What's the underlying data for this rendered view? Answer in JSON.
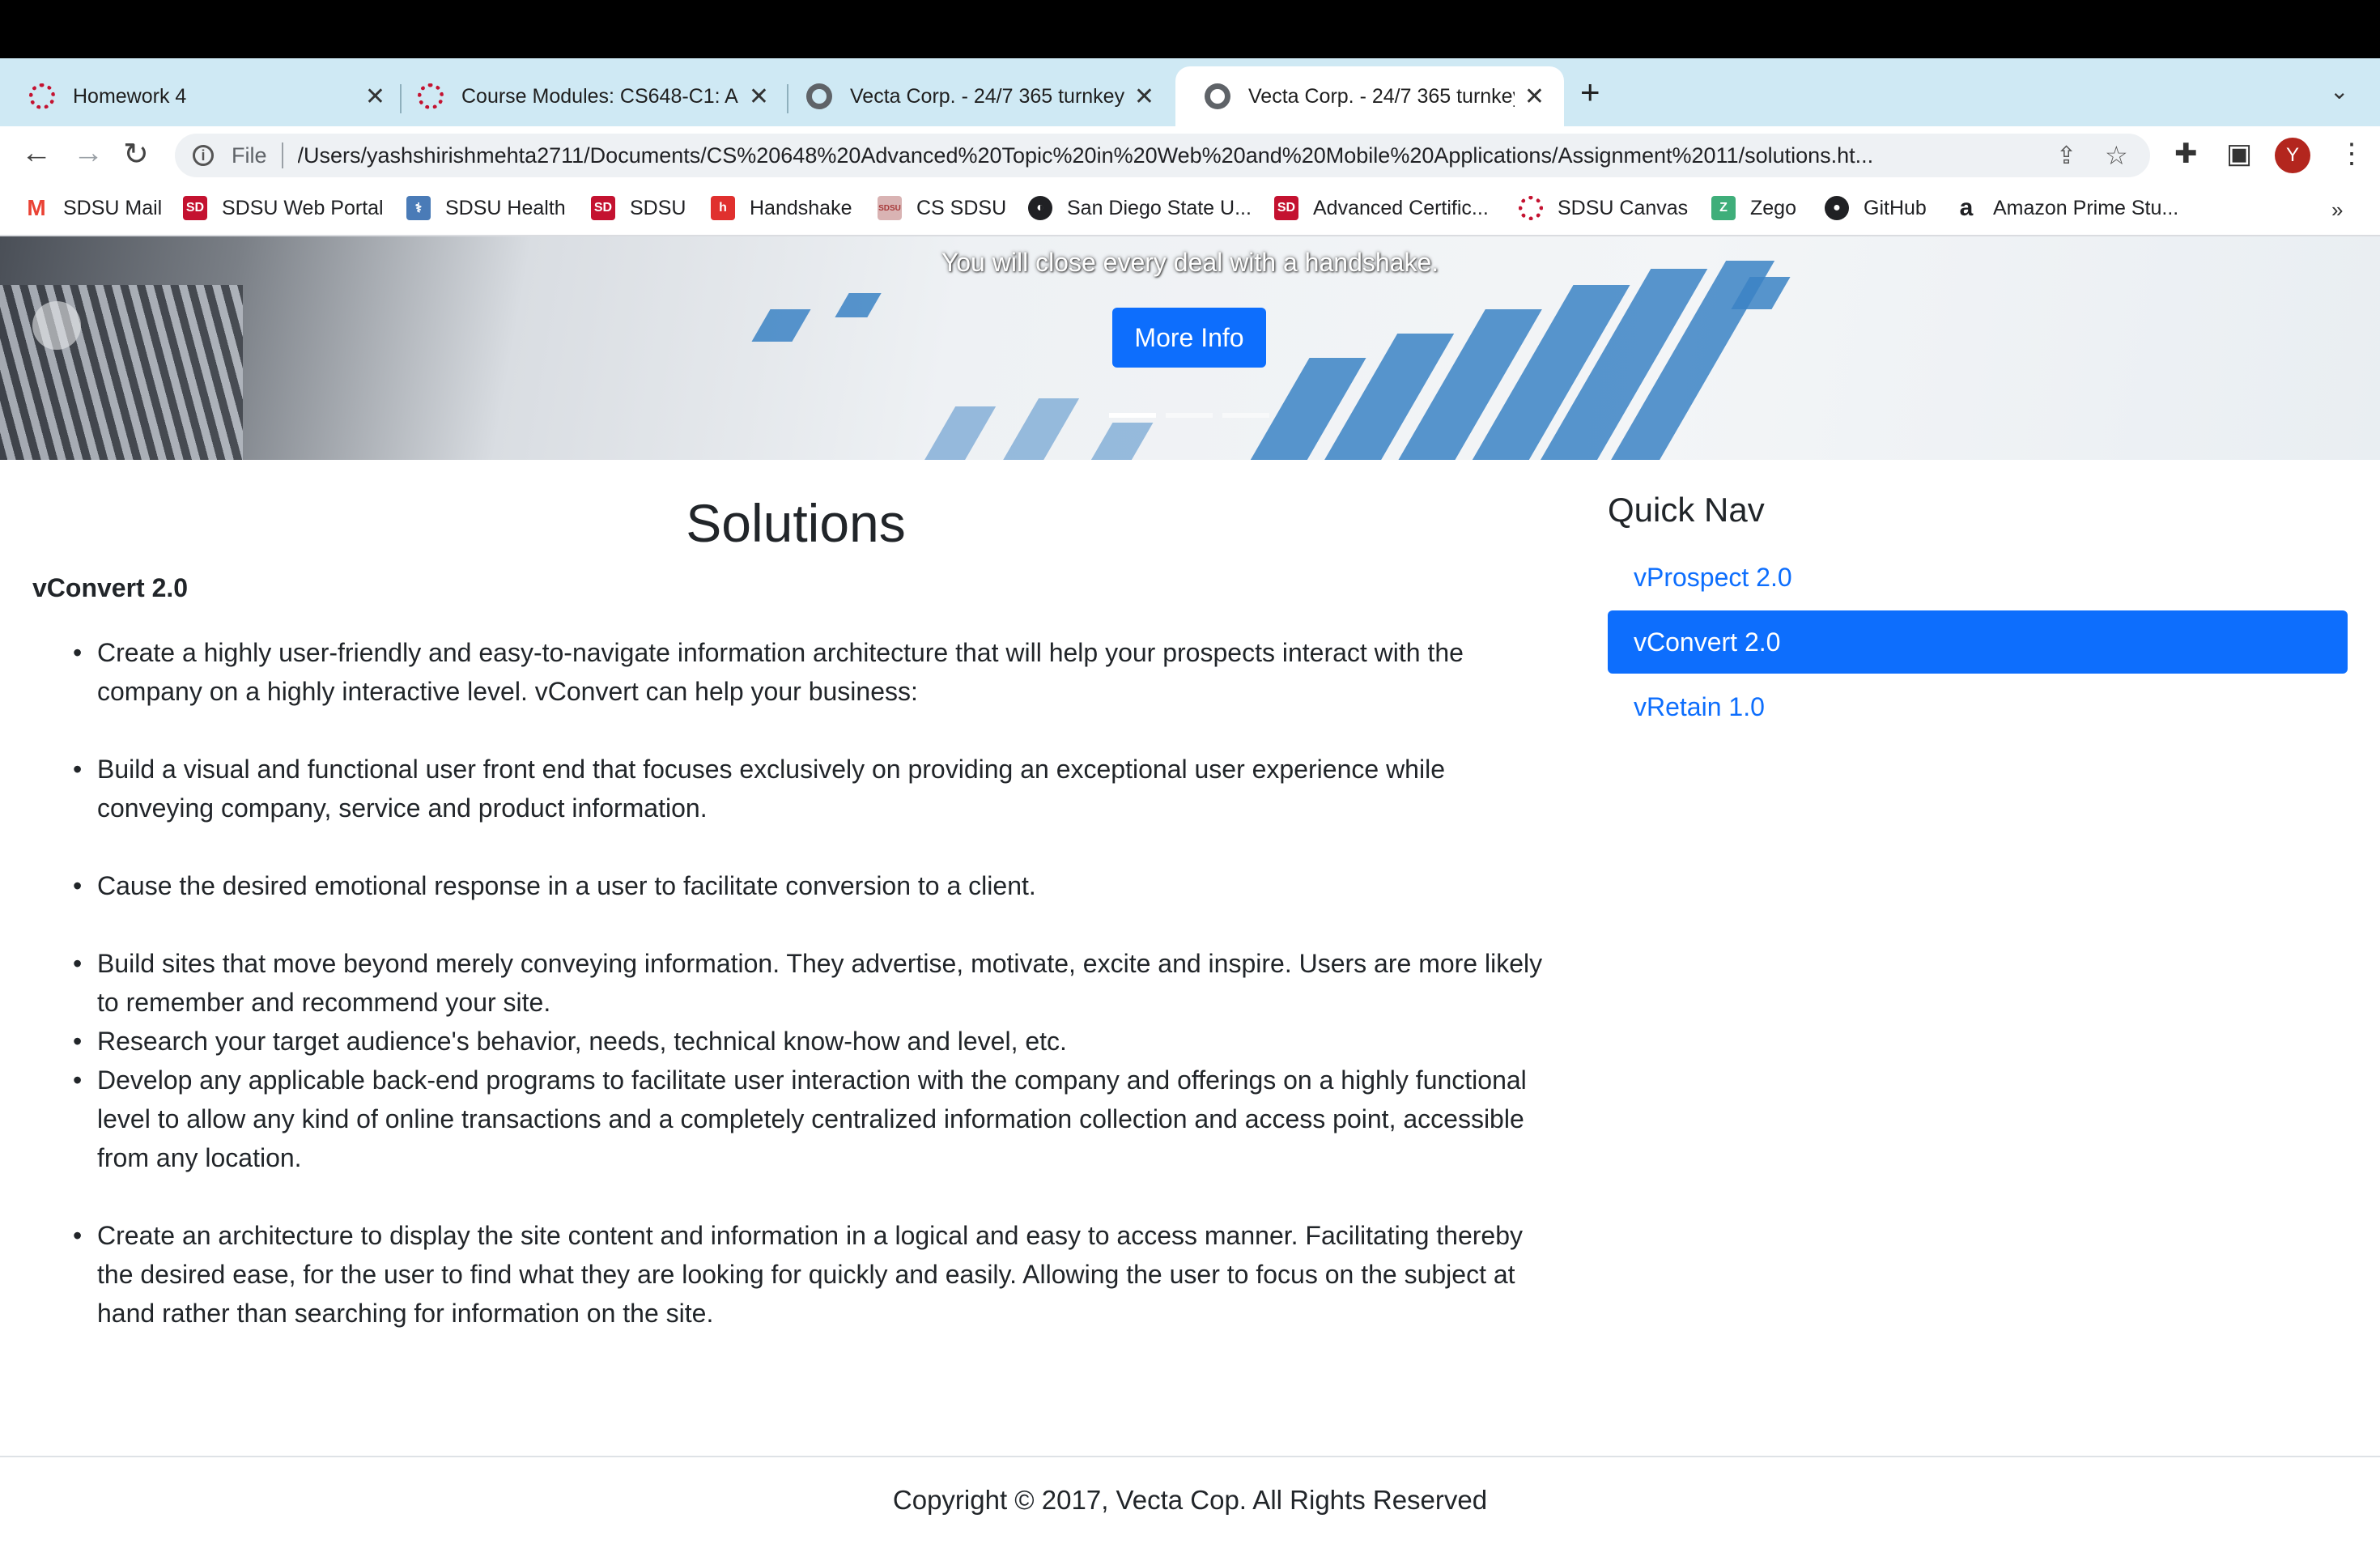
{
  "browser": {
    "tabs": [
      {
        "title": "Homework 4",
        "icon": "sdsu-canvas-icon"
      },
      {
        "title": "Course Modules: CS648-C1: A",
        "icon": "sdsu-canvas-icon"
      },
      {
        "title": "Vecta Corp. - 24/7 365 turnkey",
        "icon": "globe-icon"
      },
      {
        "title": "Vecta Corp. - 24/7 365 turnkey",
        "icon": "globe-icon"
      }
    ],
    "new_tab": "+",
    "close_glyph": "✕",
    "scheme": "File",
    "url": "/Users/yashshirishmehta2711/Documents/CS%20648%20Advanced%20Topic%20in%20Web%20and%20Mobile%20Applications/Assignment%2011/solutions.ht...",
    "avatar_letter": "Y",
    "bookmarks": [
      {
        "label": "SDSU Mail",
        "icon": "gmail-icon",
        "color": "#ea4335"
      },
      {
        "label": "SDSU Web Portal",
        "icon": "sdsu-icon",
        "color": "#c41230"
      },
      {
        "label": "SDSU Health",
        "icon": "health-icon",
        "color": "#4a7bb7"
      },
      {
        "label": "SDSU",
        "icon": "sdsu-icon",
        "color": "#c41230"
      },
      {
        "label": "Handshake",
        "icon": "handshake-icon",
        "color": "#e0302e"
      },
      {
        "label": "CS SDSU",
        "icon": "cs-sdsu-icon",
        "color": "#a83a3a"
      },
      {
        "label": "San Diego State U...",
        "icon": "globe-icon",
        "color": "#202124"
      },
      {
        "label": "Advanced Certific...",
        "icon": "sdsu-icon",
        "color": "#c41230"
      },
      {
        "label": "SDSU Canvas",
        "icon": "sdsu-canvas-icon",
        "color": "#c41230"
      },
      {
        "label": "Zego",
        "icon": "zego-icon",
        "color": "#3fae7a"
      },
      {
        "label": "GitHub",
        "icon": "github-icon",
        "color": "#202124"
      },
      {
        "label": "Amazon Prime Stu...",
        "icon": "amazon-icon",
        "color": "#202124"
      }
    ],
    "overflow": "»"
  },
  "hero": {
    "caption": "You will close every deal with a handshake.",
    "button": "More Info"
  },
  "content": {
    "title": "Solutions",
    "product": "vConvert 2.0",
    "bullets": [
      "Create a highly user-friendly and easy-to-navigate information architecture that will help your prospects interact with the company on a highly interactive level. vConvert can help your business:",
      "Build a visual and functional user front end that focuses exclusively on providing an exceptional user experience while conveying company, service and product information.",
      "Cause the desired emotional response in a user to facilitate conversion to a client.",
      "Build sites that move beyond merely conveying information. They advertise, motivate, excite and inspire. Users are more likely to remember and recommend your site.",
      "Research your target audience's behavior, needs, technical know-how and level, etc.",
      "Develop any applicable back-end programs to facilitate user interaction with the company and offerings on a highly functional level to allow any kind of online transactions and a completely centralized information collection and access point, accessible from any location.",
      "Create an architecture to display the site content and information in a logical and easy to access manner. Facilitating thereby the desired ease, for the user to find what they are looking for quickly and easily. Allowing the user to focus on the subject at hand rather than searching for information on the site."
    ]
  },
  "quick_nav": {
    "title": "Quick Nav",
    "items": [
      "vProspect 2.0",
      "vConvert 2.0",
      "vRetain 1.0"
    ],
    "active_index": 1
  },
  "footer": {
    "copyright": "Copyright © 2017, Vecta Cop. All Rights Reserved"
  },
  "colors": {
    "primary": "#0d6efd",
    "tabstrip": "#cfe9f4"
  }
}
